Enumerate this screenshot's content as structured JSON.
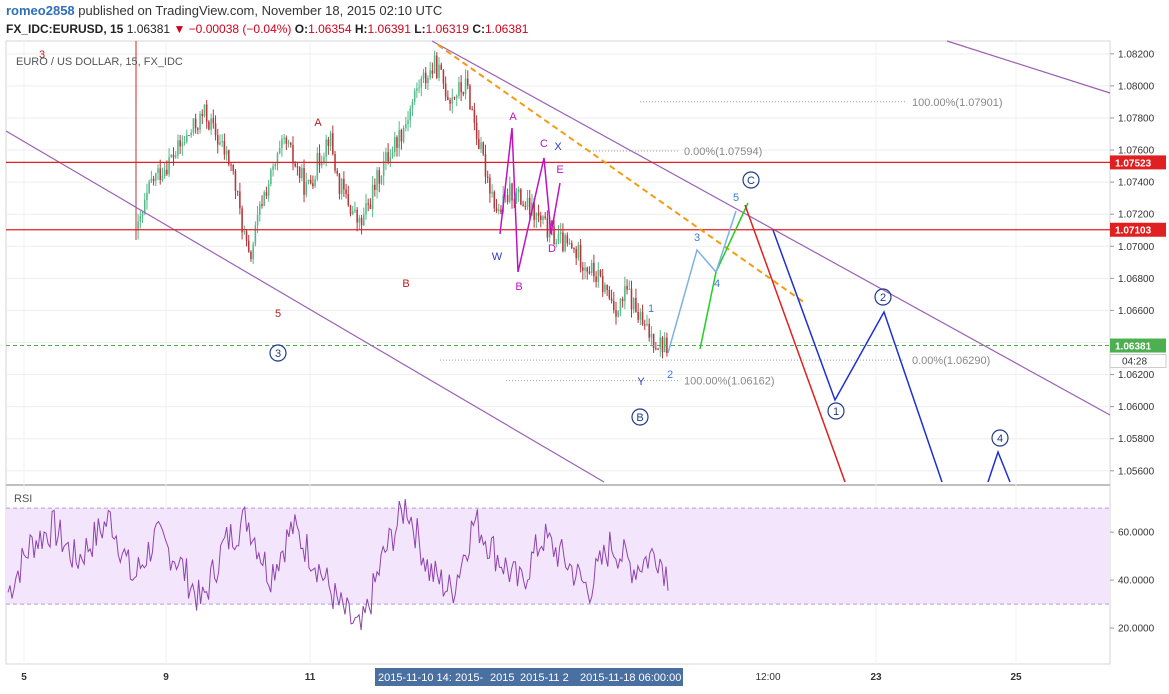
{
  "header": {
    "author": "romeo2858",
    "published_text": "published on TradingView.com, November 18, 2015 02:10 UTC",
    "symbol": "FX_IDC:EURUSD, 15",
    "last": "1.06381",
    "change_arrow": "▼",
    "change": "−0.00038 (−0.04%)",
    "open_label": "O:",
    "open": "1.06354",
    "high_label": "H:",
    "high": "1.06391",
    "low_label": "L:",
    "low": "1.06319",
    "close_label": "C:",
    "close": "1.06381"
  },
  "colors": {
    "bull": "#53b987",
    "bear": "#b5373b",
    "channel": "#9c5fb7",
    "resistance": "#e02020",
    "current_price": "#4caf50",
    "rsi_line": "#8e44ad",
    "rsi_band": "#f3e5fc",
    "fib_dotted": "#9e9e9e",
    "wave_blue": "#2e3cc4",
    "wave_magenta": "#c013c0",
    "wave_red_label": "#b22222",
    "proj_lightblue": "#7fb1e0",
    "proj_green": "#1fd01f",
    "proj_red": "#e02020",
    "proj_navy": "#1f2fd6",
    "orange_trend": "#f39c12"
  },
  "chart_data": [
    {
      "type": "line",
      "title": "EURO / US DOLLAR, 15, FX_IDC",
      "series_kind": "candlestick",
      "ylim": [
        1.0553,
        1.0828
      ],
      "y_ticks": [
        "1.08200",
        "1.08000",
        "1.07800",
        "1.07600",
        "1.07400",
        "1.07200",
        "1.07000",
        "1.06800",
        "1.06600",
        "1.06400",
        "1.06200",
        "1.06000",
        "1.05800",
        "1.05600"
      ],
      "x_ticks": [
        "5",
        "9",
        "11",
        "23",
        "25"
      ],
      "x_tick_time": "12:00",
      "x_crosshair_labels": [
        "2015-11-10 14:",
        "2015-",
        "2015",
        "2015-11 2",
        "2015-11-18 06:00:00"
      ],
      "price_path": [
        [
          0,
          1.071
        ],
        [
          3,
          1.074
        ],
        [
          9,
          1.076
        ],
        [
          15,
          1.0783
        ],
        [
          21,
          1.075
        ],
        [
          25,
          1.069
        ],
        [
          28,
          1.073
        ],
        [
          33,
          1.0765
        ],
        [
          38,
          1.0735
        ],
        [
          43,
          1.077
        ],
        [
          45,
          1.074
        ],
        [
          50,
          1.0712
        ],
        [
          55,
          1.075
        ],
        [
          60,
          1.0776
        ],
        [
          63,
          1.08
        ],
        [
          67,
          1.0813
        ],
        [
          70,
          1.0793
        ],
        [
          74,
          1.08
        ],
        [
          77,
          1.076
        ],
        [
          81,
          1.072
        ],
        [
          84,
          1.0735
        ],
        [
          89,
          1.072
        ],
        [
          94,
          1.0705
        ],
        [
          99,
          1.0695
        ],
        [
          104,
          1.0678
        ],
        [
          108,
          1.066
        ],
        [
          110,
          1.0672
        ],
        [
          114,
          1.0648
        ],
        [
          117,
          1.064
        ],
        [
          119,
          1.0638
        ]
      ],
      "current_price": "1.06381",
      "countdown": "04:28",
      "horizontal_levels": [
        "1.07523",
        "1.07103"
      ],
      "fib_labels": [
        "100.00%(1.07901)",
        "0.00%(1.07594)",
        "0.00%(1.06290)",
        "100.00%(1.06162)"
      ],
      "fib_values": [
        1.07901,
        1.07594,
        1.0629,
        1.06162
      ],
      "wave_labels_red": [
        "3",
        "A",
        "B",
        "5"
      ],
      "wave_labels_magenta": [
        "A",
        "C",
        "E",
        "B",
        "D",
        "W",
        "X",
        "Y"
      ],
      "wave_labels_blue": [
        "1",
        "2",
        "3",
        "4",
        "5"
      ],
      "circled_labels": [
        "3",
        "B",
        "C",
        "1",
        "2",
        "4"
      ]
    },
    {
      "type": "line",
      "title": "RSI",
      "ylim": [
        5,
        78
      ],
      "band": [
        30,
        70
      ],
      "y_ticks": [
        "60.0000",
        "40.0000",
        "20.0000"
      ],
      "keypoints": [
        [
          0,
          35
        ],
        [
          4,
          55
        ],
        [
          8,
          62
        ],
        [
          12,
          48
        ],
        [
          18,
          66
        ],
        [
          22,
          40
        ],
        [
          26,
          58
        ],
        [
          30,
          48
        ],
        [
          34,
          30
        ],
        [
          38,
          55
        ],
        [
          42,
          66
        ],
        [
          46,
          42
        ],
        [
          50,
          62
        ],
        [
          54,
          48
        ],
        [
          58,
          30
        ],
        [
          62,
          18
        ],
        [
          66,
          50
        ],
        [
          70,
          72
        ],
        [
          74,
          44
        ],
        [
          78,
          35
        ],
        [
          82,
          65
        ],
        [
          86,
          50
        ],
        [
          90,
          38
        ],
        [
          94,
          58
        ],
        [
          98,
          48
        ],
        [
          102,
          36
        ],
        [
          106,
          55
        ],
        [
          110,
          45
        ],
        [
          114,
          52
        ],
        [
          116,
          42
        ]
      ]
    }
  ]
}
